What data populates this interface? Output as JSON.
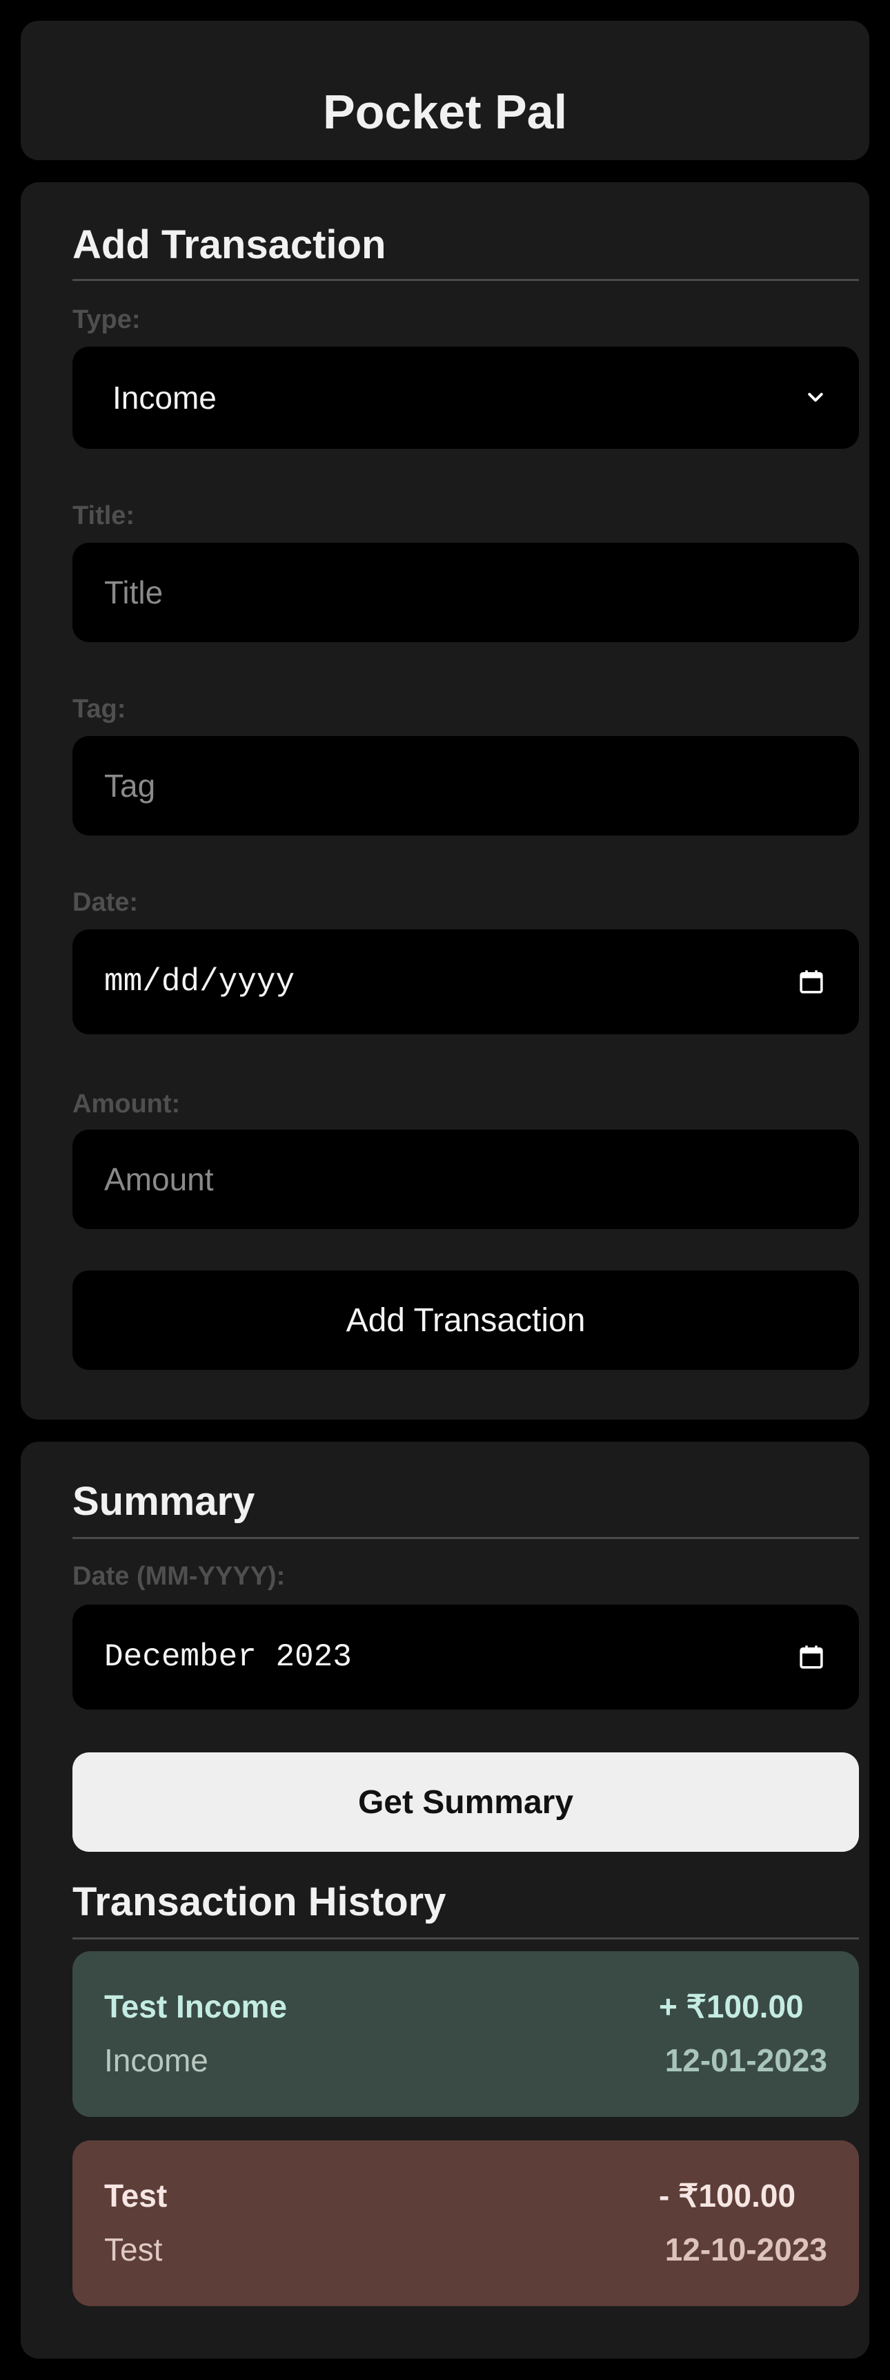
{
  "app": {
    "title": "Pocket Pal"
  },
  "add_transaction": {
    "heading": "Add Transaction",
    "type": {
      "label": "Type:",
      "value": "Income"
    },
    "title": {
      "label": "Title:",
      "placeholder": "Title"
    },
    "tag": {
      "label": "Tag:",
      "placeholder": "Tag"
    },
    "date": {
      "label": "Date:",
      "placeholder": "mm/dd/yyyy"
    },
    "amount": {
      "label": "Amount:",
      "placeholder": "Amount"
    },
    "submit_label": "Add Transaction"
  },
  "summary": {
    "heading": "Summary",
    "date": {
      "label": "Date (MM-YYYY):",
      "value": "December 2023"
    },
    "button_label": "Get Summary"
  },
  "history": {
    "heading": "Transaction History",
    "items": [
      {
        "title": "Test Income",
        "tag": "Income",
        "amount": "+ ₹100.00",
        "date": "12-01-2023",
        "kind": "income"
      },
      {
        "title": "Test",
        "tag": "Test",
        "amount": "- ₹100.00",
        "date": "12-10-2023",
        "kind": "expense"
      }
    ]
  },
  "icons": {
    "select_arrow": "chevron-down-icon",
    "date_picker": "calendar-icon"
  },
  "colors": {
    "background": "#000000",
    "card": "#1b1b1b",
    "income_card": "#3a4a44",
    "expense_card": "#5e3e39",
    "primary_button": "#efefef"
  }
}
